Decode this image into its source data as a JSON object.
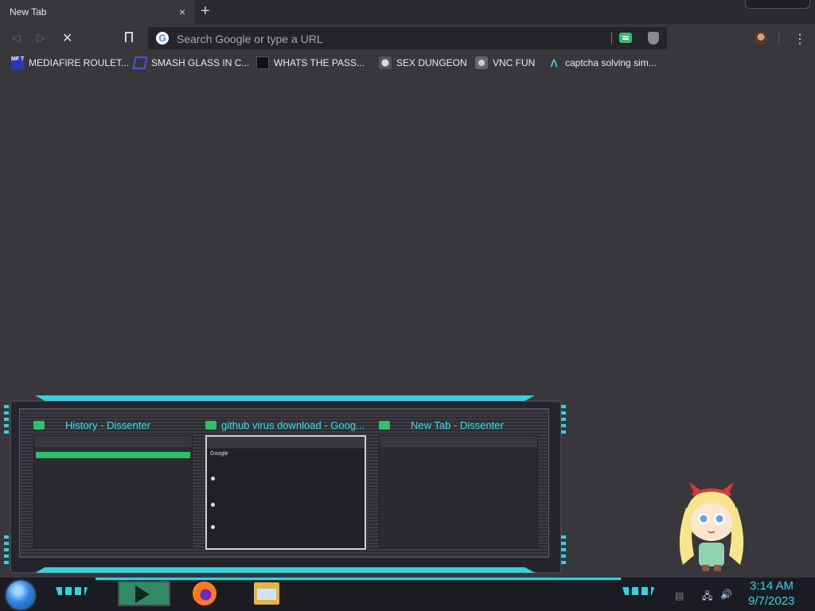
{
  "browser": {
    "tab": {
      "title": "New Tab",
      "close_glyph": "×"
    },
    "new_tab_glyph": "+",
    "nav": {
      "back_glyph": "◁",
      "forward_glyph": "▷",
      "stop_glyph": "✕"
    },
    "omnibox": {
      "placeholder": "Search Google or type a URL",
      "value": "",
      "icon": "google-g-icon"
    },
    "extensions": [
      "dissenter-icon",
      "shield-icon"
    ],
    "menu_glyph": "⋮"
  },
  "bookmarks": [
    {
      "label": "MEDIAFIRE ROULET...",
      "icon": "mediafire-icon",
      "icon_text": "MF T"
    },
    {
      "label": "SMASH GLASS IN C...",
      "icon": "smash-glass-icon"
    },
    {
      "label": "WHATS THE PASS...",
      "icon": "password-site-icon"
    },
    {
      "label": "SEX DUNGEON",
      "icon": "dungeon-icon"
    },
    {
      "label": "VNC FUN",
      "icon": "vnc-icon"
    },
    {
      "label": "captcha solving sim...",
      "icon": "captcha-icon",
      "icon_text": "Λ"
    }
  ],
  "previews": [
    {
      "title": "History - Dissenter"
    },
    {
      "title": "github virus download - Goog...",
      "shot_logo": "Google"
    },
    {
      "title": "New Tab - Dissenter"
    }
  ],
  "taskbar": {
    "apps": [
      "dissenter-taskbar-icon",
      "firefox-icon",
      "file-explorer-icon"
    ],
    "time": "3:14 AM",
    "date": "9/7/2023",
    "accent": "#29d6e6"
  }
}
